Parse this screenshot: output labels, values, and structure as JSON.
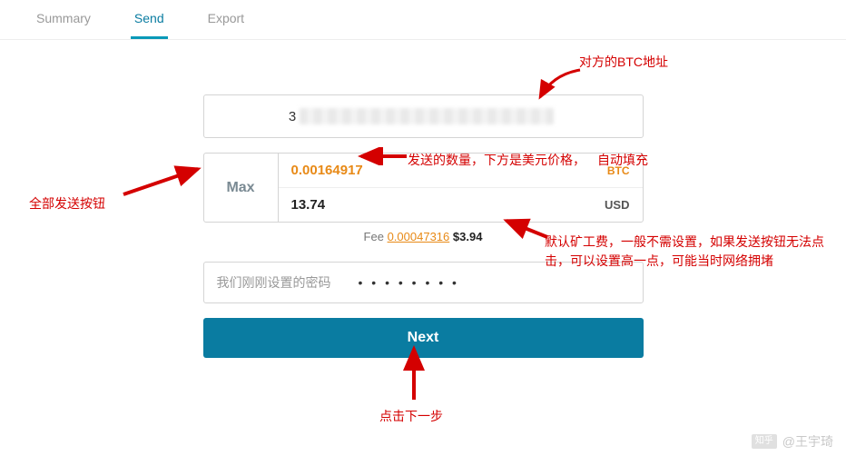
{
  "tabs": {
    "summary": "Summary",
    "send": "Send",
    "export": "Export"
  },
  "address": {
    "prefix": "3",
    "suffix": ""
  },
  "amount": {
    "max_label": "Max",
    "btc": "0.00164917",
    "btc_cur": "BTC",
    "usd": "13.74",
    "usd_cur": "USD"
  },
  "fee": {
    "label": "Fee",
    "btc": "0.00047316",
    "usd": "$3.94"
  },
  "password": {
    "note": "我们刚刚设置的密码",
    "dots": "• • • • • • • •"
  },
  "next_label": "Next",
  "annotations": {
    "addr": "对方的BTC地址",
    "amount": "发送的数量，下方是美元价格，",
    "amount2": "自动填充",
    "max": "全部发送按钮",
    "fee": "默认矿工费，一般不需设置，如果发送按钮无法点击，可以设置高一点，可能当时网络拥堵",
    "next": "点击下一步"
  },
  "watermark": {
    "brand": "知乎",
    "author": "@王宇琦"
  }
}
